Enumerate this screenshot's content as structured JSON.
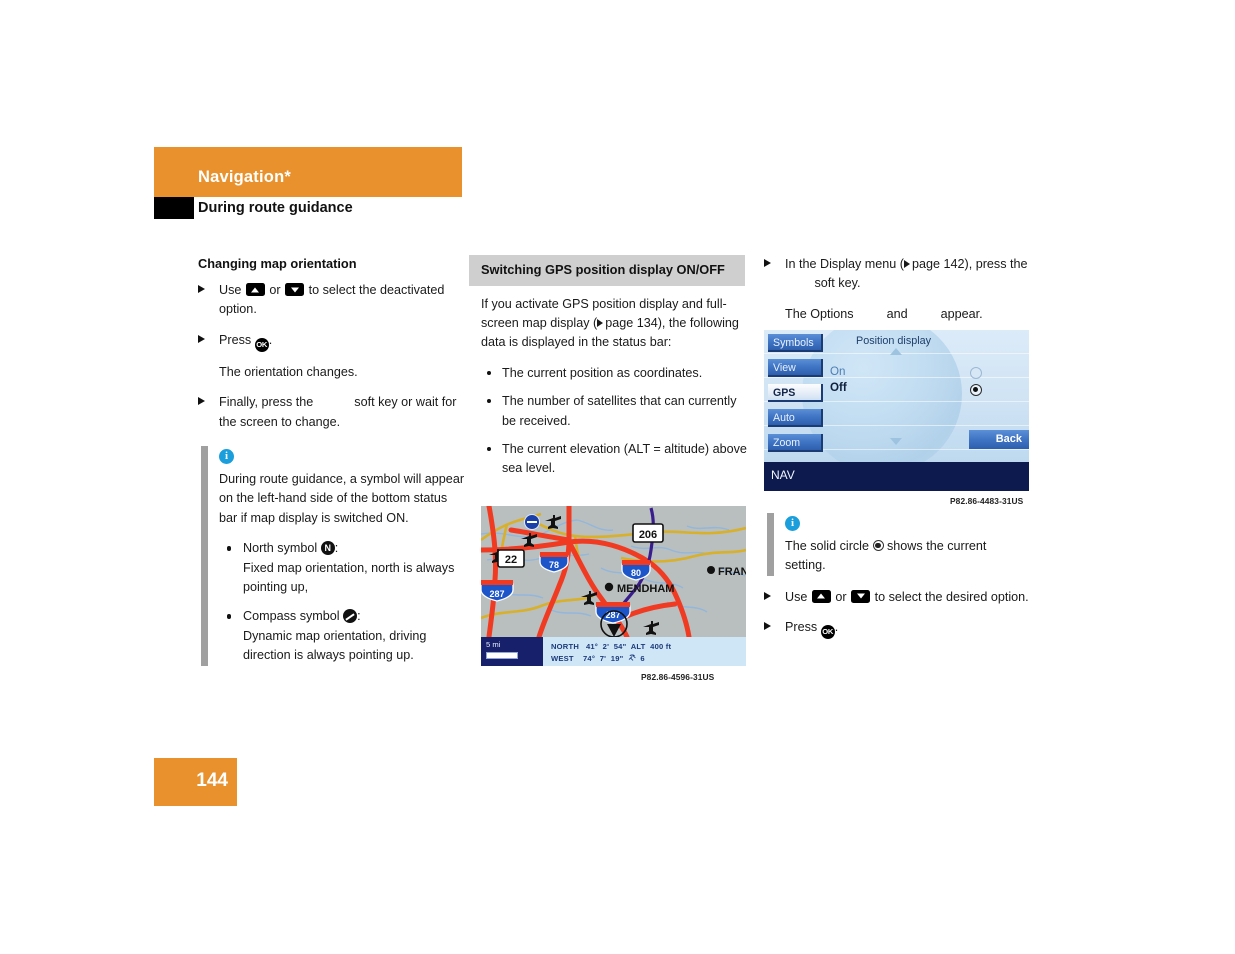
{
  "header": {
    "chapter_title": "Navigation*",
    "section_title": "During route guidance",
    "bar_color": "#e8912d"
  },
  "page_number": "144",
  "col1": {
    "heading": "Changing map orientation",
    "step1_a": "Use",
    "step1_b": "or",
    "step1_c": "to select the deactivated option.",
    "step2": "Press",
    "step2_end": ".",
    "step2_result": "The orientation changes.",
    "step3_a": "Finally, press the",
    "step3_b": "soft key or wait for the screen to change.",
    "note_body": "During route guidance, a symbol will appear on the left-hand side of the bottom status bar if map display is switched ON.",
    "bullet1_label": "North symbol",
    "bullet1_text": "Fixed map orientation, north is always pointing up,",
    "bullet2_label": "Compass symbol",
    "bullet2_text": "Dynamic map orientation, driving direction is always pointing up."
  },
  "col2": {
    "heading": "Switching GPS position display ON/OFF",
    "intro_a": "If you activate GPS position display and full-screen map display (",
    "intro_page": "page 134",
    "intro_b": "), the following data is displayed in the status bar:",
    "bullets": [
      "The current position as coordinates.",
      "The number of satellites that can currently be received.",
      "The current elevation (ALT = altitude) above sea level."
    ],
    "figure_caption": "P82.86-4596-31US",
    "map": {
      "scale": "5 mi",
      "lat_dir": "NORTH",
      "lat_deg": "41°",
      "lat_min": "2'",
      "lat_sec": "54\"",
      "alt_label": "ALT",
      "alt_value": "400 ft",
      "lon_dir": "WEST",
      "lon_deg": "74°",
      "lon_min": "7'",
      "lon_sec": "19\"",
      "sat_count": "6",
      "city_label": "MENDHAM",
      "city_label2": "FRAN",
      "shields": [
        "22",
        "78",
        "287",
        "206",
        "80",
        "287"
      ]
    }
  },
  "col3": {
    "step1_a": "In the Display menu (",
    "step1_page": "page 142",
    "step1_b": "), press the",
    "step1_c": "soft key.",
    "step1_result_a": "The Options",
    "step1_result_b": "and",
    "step1_result_c": "appear.",
    "figure_caption": "P82.86-4483-31US",
    "note_a": "The solid circle",
    "note_b": "shows the current setting.",
    "step2_a": "Use",
    "step2_b": "or",
    "step2_c": "to select the desired option.",
    "step3": "Press",
    "step3_end": ".",
    "navscreen": {
      "title": "Position display",
      "buttons": [
        "Symbols",
        "View",
        "GPS",
        "Auto",
        "Zoom"
      ],
      "selected_button": "GPS",
      "option_on": "On",
      "option_off": "Off",
      "selected_option": "Off",
      "back_label": "Back",
      "status_label": "NAV"
    }
  }
}
